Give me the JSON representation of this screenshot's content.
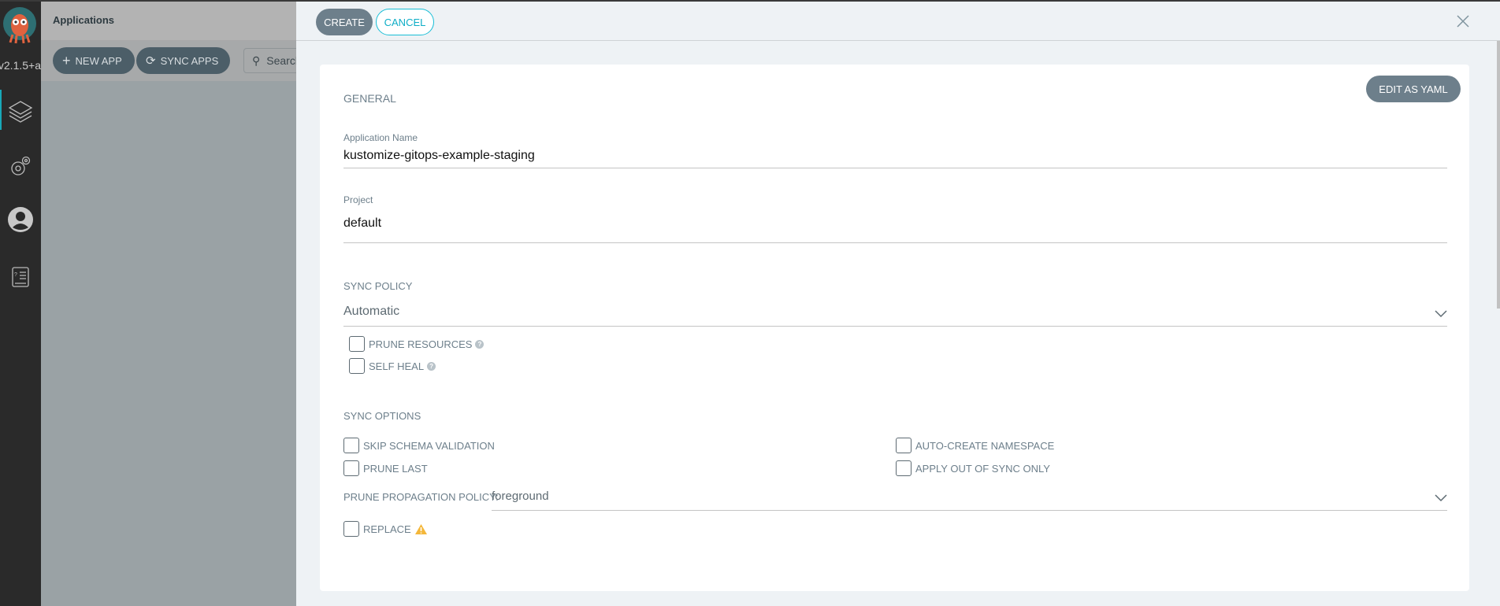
{
  "sidebar": {
    "version": "v2.1.5+a",
    "items": [
      {
        "icon": "layers-icon",
        "active": true
      },
      {
        "icon": "gear-icon"
      },
      {
        "icon": "user-icon"
      },
      {
        "icon": "docs-icon"
      }
    ],
    "accent": "#18a8b8"
  },
  "applications": {
    "title": "Applications",
    "new_app": "NEW APP",
    "sync_apps": "SYNC APPS",
    "search_placeholder": "Search"
  },
  "panel": {
    "create": "CREATE",
    "cancel": "CANCEL",
    "edit_yaml": "EDIT AS YAML",
    "general": {
      "title": "GENERAL",
      "app_name_label": "Application Name",
      "app_name": "kustomize-gitops-example-staging",
      "project_label": "Project",
      "project": "default"
    },
    "sync_policy": {
      "title": "SYNC POLICY",
      "value": "Automatic",
      "prune_resources": "PRUNE RESOURCES",
      "self_heal": "SELF HEAL"
    },
    "sync_options": {
      "title": "SYNC OPTIONS",
      "skip_schema": "SKIP SCHEMA VALIDATION",
      "prune_last": "PRUNE LAST",
      "auto_create_ns": "AUTO-CREATE NAMESPACE",
      "apply_out_of_sync": "APPLY OUT OF SYNC ONLY",
      "prune_propagation_label": "PRUNE PROPAGATION POLICY:",
      "prune_propagation": "foreground",
      "replace": "REPLACE"
    }
  }
}
